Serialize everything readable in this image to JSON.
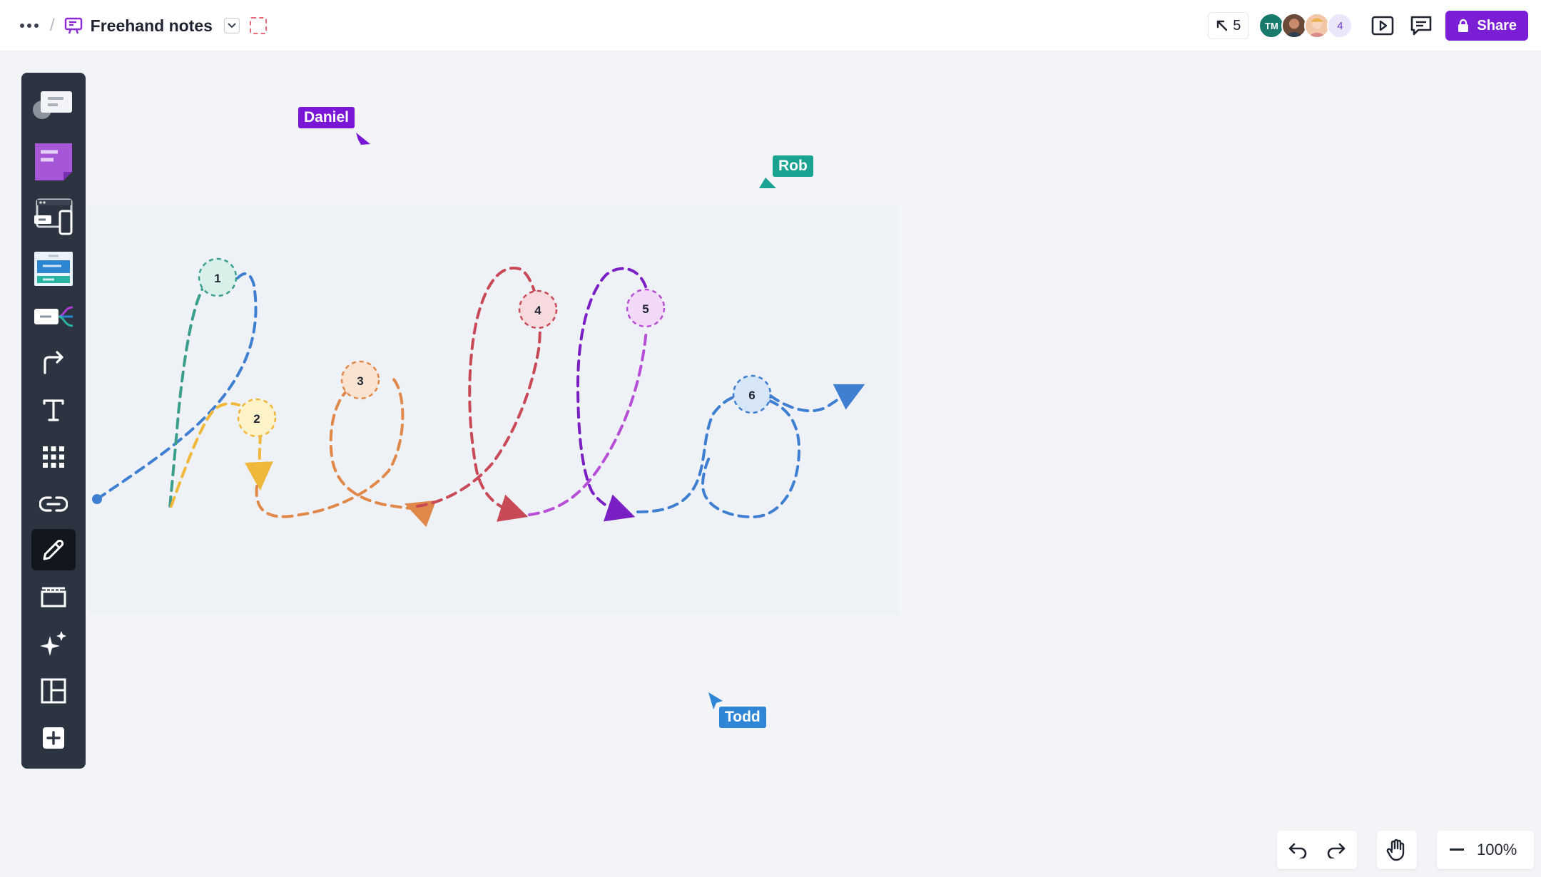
{
  "header": {
    "title": "Freehand notes",
    "cursor_count": "5",
    "avatars": [
      {
        "initials": "TM"
      },
      {
        "initials": ""
      },
      {
        "initials": ""
      },
      {
        "initials": "4"
      }
    ],
    "share_label": "Share"
  },
  "toolbar": {
    "items": [
      "comment-card",
      "sticky-note",
      "devices",
      "template-card",
      "mindmap",
      "connector",
      "text",
      "grid",
      "link",
      "pen",
      "frame",
      "ai-sparkle",
      "layout",
      "add"
    ],
    "active": "pen"
  },
  "canvas": {
    "markers": [
      "1",
      "2",
      "3",
      "4",
      "5",
      "6"
    ],
    "collaborators": [
      {
        "name": "Daniel",
        "color": "#7a16d6"
      },
      {
        "name": "Rob",
        "color": "#1aa391"
      },
      {
        "name": "Todd",
        "color": "#2f86d6"
      }
    ]
  },
  "zoom": {
    "level": "100%"
  },
  "colors": {
    "accent": "#7a1fd6",
    "stroke_blue": "#3f7fd1",
    "stroke_teal": "#3b9e8c",
    "stroke_yellow": "#f0b83a",
    "stroke_orange": "#e0884a",
    "stroke_red": "#c94a57",
    "stroke_purple": "#7a1fc4",
    "stroke_violet": "#b64fd6"
  }
}
